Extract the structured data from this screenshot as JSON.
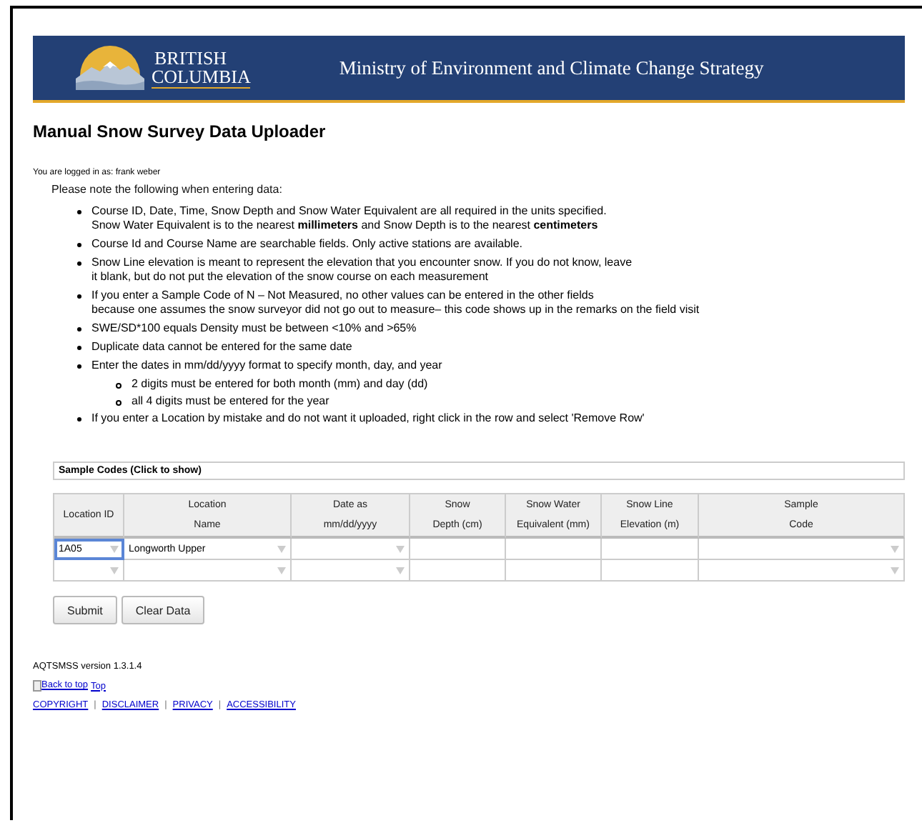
{
  "banner": {
    "logo_line1": "BRITISH",
    "logo_line2": "COLUMBIA",
    "ministry": "Ministry of Environment and Climate Change Strategy"
  },
  "page_title": "Manual Snow Survey Data Uploader",
  "login_status": "You are logged in as: frank weber",
  "notes": {
    "intro": "Please note the following when entering data:",
    "items": [
      {
        "lines": [
          "Course ID, Date, Time, Snow Depth and Snow Water Equivalent are all required in the units specified.",
          "Snow Water Equivalent is to the nearest **millimeters** and Snow Depth is to the nearest **centimeters**"
        ]
      },
      {
        "lines": [
          "Course Id and Course Name are searchable fields. Only active stations are available."
        ]
      },
      {
        "lines": [
          "Snow Line elevation is meant to represent the elevation that you encounter snow. If you do not know, leave",
          "it blank, but do not put the elevation of the snow course on each measurement"
        ]
      },
      {
        "lines": [
          "If you enter a Sample Code of N – Not Measured, no other values can be entered in the other fields",
          "because one assumes the snow surveyor did not go out to measure– this code shows up in the remarks on the field visit"
        ]
      },
      {
        "lines": [
          "SWE/SD*100 equals Density must be between <10% and >65%"
        ]
      },
      {
        "lines": [
          "Duplicate data cannot be entered for the same date"
        ]
      },
      {
        "lines": [
          "Enter the dates in mm/dd/yyyy format to specify month, day, and year"
        ],
        "children": [
          {
            "lines": [
              "2 digits must be entered for both month (mm) and day (dd)"
            ]
          },
          {
            "lines": [
              "all 4 digits must be entered for the year"
            ]
          }
        ]
      },
      {
        "lines": [
          "If you enter a Location by mistake and do not want it uploaded, right click in the row and select 'Remove Row'"
        ]
      }
    ]
  },
  "sample_codes_toggle": "Sample Codes (Click to show)",
  "table": {
    "columns": [
      {
        "lines": [
          "Location ID"
        ],
        "kind": "dropdown"
      },
      {
        "lines": [
          "Location",
          "Name"
        ],
        "kind": "dropdown"
      },
      {
        "lines": [
          "Date as",
          "mm/dd/yyyy"
        ],
        "kind": "dropdown"
      },
      {
        "lines": [
          "Snow",
          "Depth (cm)"
        ],
        "kind": "text"
      },
      {
        "lines": [
          "Snow Water",
          "Equivalent (mm)"
        ],
        "kind": "text"
      },
      {
        "lines": [
          "Snow Line",
          "Elevation (m)"
        ],
        "kind": "text"
      },
      {
        "lines": [
          "Sample",
          "Code"
        ],
        "kind": "dropdown"
      }
    ],
    "rows": [
      {
        "cells": [
          {
            "value": "1A05",
            "focused": true
          },
          {
            "value": "Longworth Upper",
            "focused": false
          },
          {
            "focused": false
          },
          {
            "focused": false
          },
          {
            "focused": false
          },
          {
            "focused": false
          },
          {
            "focused": false
          }
        ]
      },
      {
        "cells": [
          {
            "focused": false
          },
          {
            "focused": false
          },
          {
            "focused": false
          },
          {
            "focused": false
          },
          {
            "focused": false
          },
          {
            "focused": false
          },
          {
            "focused": false
          }
        ]
      }
    ]
  },
  "buttons": [
    "Submit",
    "Clear Data"
  ],
  "footer": {
    "version": "AQTSMSS version 1.3.1.4",
    "back_to_top_alt": "Back to top",
    "back_to_top_link": "Top",
    "links": [
      "COPYRIGHT",
      "DISCLAIMER",
      "PRIVACY",
      "ACCESSIBILITY"
    ],
    "separators": [
      "|",
      "|",
      "|"
    ]
  }
}
